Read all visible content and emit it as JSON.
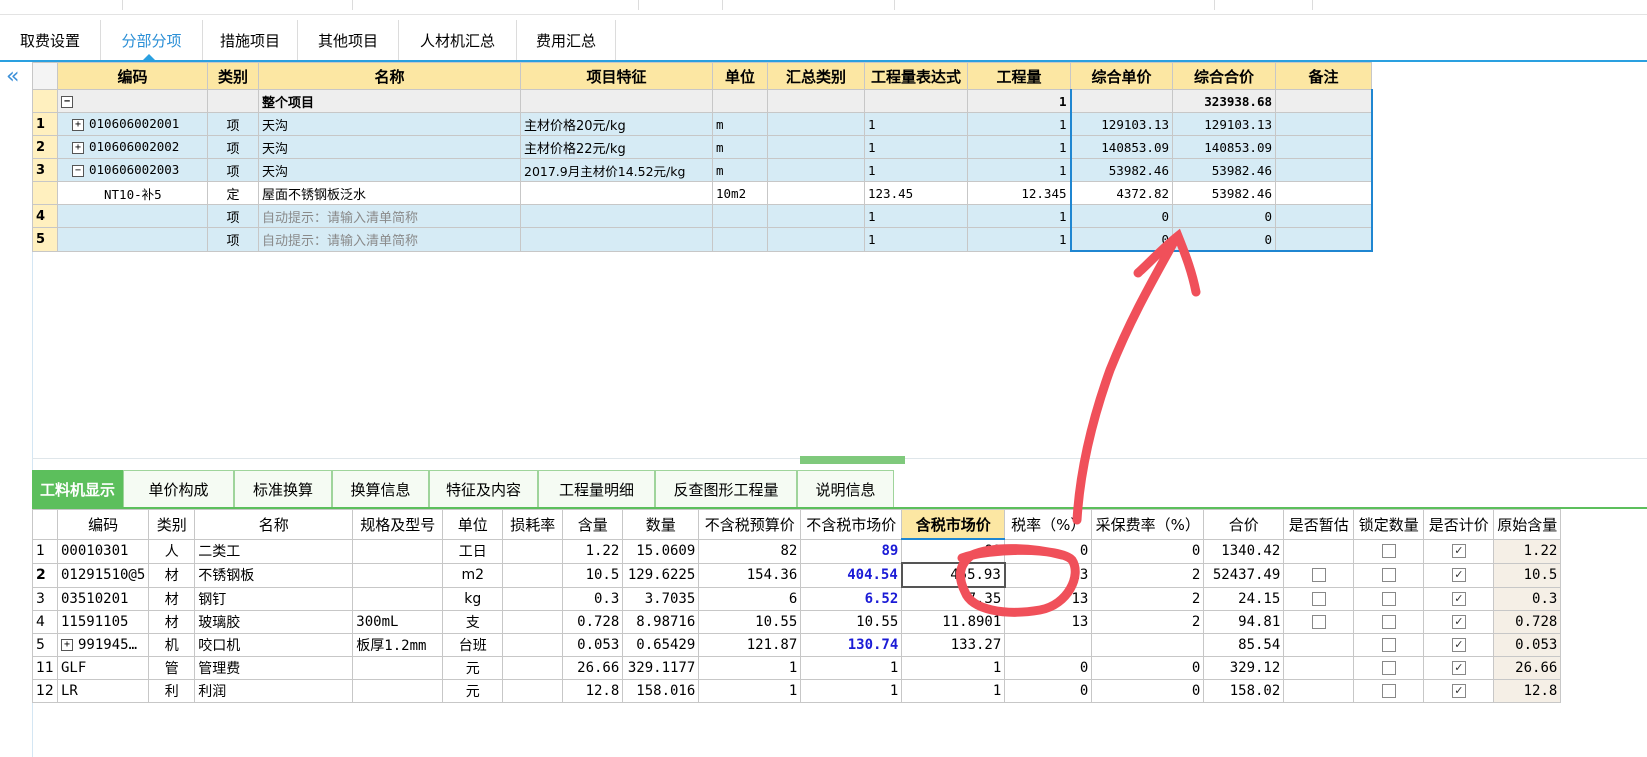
{
  "main_tabs": [
    {
      "label": "取费设置",
      "active": false
    },
    {
      "label": "分部分项",
      "active": true
    },
    {
      "label": "措施项目",
      "active": false
    },
    {
      "label": "其他项目",
      "active": false
    },
    {
      "label": "人材机汇总",
      "active": false
    },
    {
      "label": "费用汇总",
      "active": false
    }
  ],
  "collapse_icon": "«",
  "top_grid": {
    "headers": [
      "编码",
      "类别",
      "名称",
      "项目特征",
      "单位",
      "汇总类别",
      "工程量表达式",
      "工程量",
      "综合单价",
      "综合合价",
      "备注"
    ],
    "rows": [
      {
        "idx": "",
        "tree": "−",
        "code": "",
        "type": "",
        "name": "整个项目",
        "feature": "",
        "unit": "",
        "summary": "",
        "expr": "",
        "qty": "1",
        "unit_price": "",
        "total": "323938.68",
        "remark": ""
      },
      {
        "idx": "1",
        "tree": "+",
        "code": "010606002001",
        "type": "项",
        "name": "天沟",
        "feature": "主材价格20元/kg",
        "unit": "m",
        "summary": "",
        "expr": "1",
        "qty": "1",
        "unit_price": "129103.13",
        "total": "129103.13",
        "remark": ""
      },
      {
        "idx": "2",
        "tree": "+",
        "code": "010606002002",
        "type": "项",
        "name": "天沟",
        "feature": "主材价格22元/kg",
        "unit": "m",
        "summary": "",
        "expr": "1",
        "qty": "1",
        "unit_price": "140853.09",
        "total": "140853.09",
        "remark": ""
      },
      {
        "idx": "3",
        "tree": "−",
        "code": "010606002003",
        "type": "项",
        "name": "天沟",
        "feature": "2017.9月主材价14.52元/kg",
        "unit": "m",
        "summary": "",
        "expr": "1",
        "qty": "1",
        "unit_price": "53982.46",
        "total": "53982.46",
        "remark": ""
      },
      {
        "idx": "",
        "tree": "",
        "code": "NT10-补5",
        "type": "定",
        "name": "屋面不锈钢板泛水",
        "feature": "",
        "unit": "10m2",
        "summary": "",
        "expr": "123.45",
        "qty": "12.345",
        "unit_price": "4372.82",
        "total": "53982.46",
        "remark": ""
      },
      {
        "idx": "4",
        "tree": "",
        "code": "",
        "type": "项",
        "name": "自动提示：请输入清单简称",
        "feature": "",
        "unit": "",
        "summary": "",
        "expr": "1",
        "qty": "1",
        "unit_price": "0",
        "total": "0",
        "remark": ""
      },
      {
        "idx": "5",
        "tree": "",
        "code": "",
        "type": "项",
        "name": "自动提示：请输入清单简称",
        "feature": "",
        "unit": "",
        "summary": "",
        "expr": "1",
        "qty": "1",
        "unit_price": "0",
        "total": "0",
        "remark": ""
      }
    ]
  },
  "bottom_tabs": [
    {
      "label": "工料机显示",
      "active": true
    },
    {
      "label": "单价构成",
      "active": false
    },
    {
      "label": "标准换算",
      "active": false
    },
    {
      "label": "换算信息",
      "active": false
    },
    {
      "label": "特征及内容",
      "active": false
    },
    {
      "label": "工程量明细",
      "active": false
    },
    {
      "label": "反查图形工程量",
      "active": false
    },
    {
      "label": "说明信息",
      "active": false
    }
  ],
  "bottom_grid": {
    "headers": [
      "编码",
      "类别",
      "名称",
      "规格及型号",
      "单位",
      "损耗率",
      "含量",
      "数量",
      "不含税预算价",
      "不含税市场价",
      "含税市场价",
      "税率（%）",
      "采保费率（%）",
      "合价",
      "是否暂估",
      "锁定数量",
      "是否计价",
      "原始含量"
    ],
    "rows": [
      {
        "idx": "1",
        "code": "00010301",
        "type": "人",
        "name": "二类工",
        "spec": "",
        "unit": "工日",
        "loss": "",
        "content": "1.22",
        "qty": "15.0609",
        "budget": "82",
        "market": "89",
        "market_blue": true,
        "tax_market": "89",
        "tax_rate": "0",
        "purchase_rate": "0",
        "total": "1340.42",
        "provisional": null,
        "locked": false,
        "priced": true,
        "orig": "1.22"
      },
      {
        "idx": "2",
        "code": "01291510@5",
        "type": "材",
        "name": "不锈钢板",
        "spec": "",
        "unit": "m2",
        "loss": "",
        "content": "10.5",
        "qty": "129.6225",
        "budget": "154.36",
        "market": "404.54",
        "market_blue": true,
        "tax_market": "455.93",
        "tax_rate": "13",
        "purchase_rate": "2",
        "total": "52437.49",
        "provisional": false,
        "locked": false,
        "priced": true,
        "orig": "10.5"
      },
      {
        "idx": "3",
        "code": "03510201",
        "type": "材",
        "name": "钢钉",
        "spec": "",
        "unit": "kg",
        "loss": "",
        "content": "0.3",
        "qty": "3.7035",
        "budget": "6",
        "market": "6.52",
        "market_blue": true,
        "tax_market": "7.35",
        "tax_rate": "13",
        "purchase_rate": "2",
        "total": "24.15",
        "provisional": false,
        "locked": false,
        "priced": true,
        "orig": "0.3"
      },
      {
        "idx": "4",
        "code": "11591105",
        "type": "材",
        "name": "玻璃胶",
        "spec": "300mL",
        "unit": "支",
        "loss": "",
        "content": "0.728",
        "qty": "8.98716",
        "budget": "10.55",
        "market": "10.55",
        "market_blue": false,
        "tax_market": "11.8901",
        "tax_rate": "13",
        "purchase_rate": "2",
        "total": "94.81",
        "provisional": false,
        "locked": false,
        "priced": true,
        "orig": "0.728"
      },
      {
        "idx": "5",
        "code": "991945…",
        "code_tree": "+",
        "type": "机",
        "name": "咬口机",
        "spec": "板厚1.2mm",
        "unit": "台班",
        "loss": "",
        "content": "0.053",
        "qty": "0.65429",
        "budget": "121.87",
        "market": "130.74",
        "market_blue": true,
        "tax_market": "133.27",
        "tax_rate": "",
        "purchase_rate": "",
        "total": "85.54",
        "provisional": null,
        "locked": false,
        "priced": true,
        "orig": "0.053"
      },
      {
        "idx": "11",
        "code": "GLF",
        "type": "管",
        "name": "管理费",
        "spec": "",
        "unit": "元",
        "loss": "",
        "content": "26.66",
        "qty": "329.1177",
        "budget": "1",
        "market": "1",
        "market_blue": false,
        "tax_market": "1",
        "tax_rate": "0",
        "purchase_rate": "0",
        "total": "329.12",
        "provisional": null,
        "locked": false,
        "priced": true,
        "orig": "26.66"
      },
      {
        "idx": "12",
        "code": "LR",
        "type": "利",
        "name": "利润",
        "spec": "",
        "unit": "元",
        "loss": "",
        "content": "12.8",
        "qty": "158.016",
        "budget": "1",
        "market": "1",
        "market_blue": false,
        "tax_market": "1",
        "tax_rate": "0",
        "purchase_rate": "0",
        "total": "158.02",
        "provisional": null,
        "locked": false,
        "priced": true,
        "orig": "12.8"
      }
    ]
  },
  "colors": {
    "accent_blue": "#2aa0e0",
    "header_yellow": "#fce7a3",
    "row_blue": "#d6ebf5",
    "tab_green": "#5cbf5c",
    "annotation_red": "#f0505a",
    "value_blue": "#1b1bd6"
  }
}
